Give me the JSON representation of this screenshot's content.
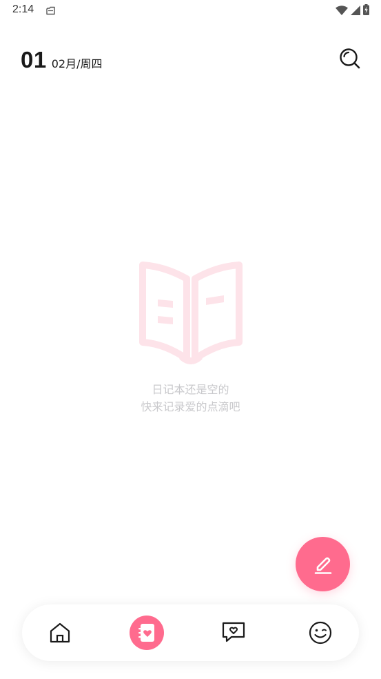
{
  "status_bar": {
    "time": "2:14",
    "icons": [
      "notification-icon",
      "wifi-icon",
      "signal-icon",
      "battery-icon"
    ]
  },
  "header": {
    "day": "01",
    "month_weekday": "02月/周四",
    "search_icon": "search-icon"
  },
  "empty_state": {
    "icon": "open-book-icon",
    "line1": "日记本还是空的",
    "line2": "快来记录爱的点滴吧"
  },
  "fab": {
    "icon": "pencil-icon"
  },
  "bottom_nav": {
    "items": [
      {
        "icon": "home-icon",
        "active": false
      },
      {
        "icon": "diary-heart-icon",
        "active": true
      },
      {
        "icon": "chat-heart-icon",
        "active": false
      },
      {
        "icon": "smiley-icon",
        "active": false
      }
    ]
  },
  "colors": {
    "accent": "#ff6b8e",
    "empty_icon": "#fde3e9",
    "empty_text": "#c9c9cc",
    "text": "#1a1a1a"
  }
}
